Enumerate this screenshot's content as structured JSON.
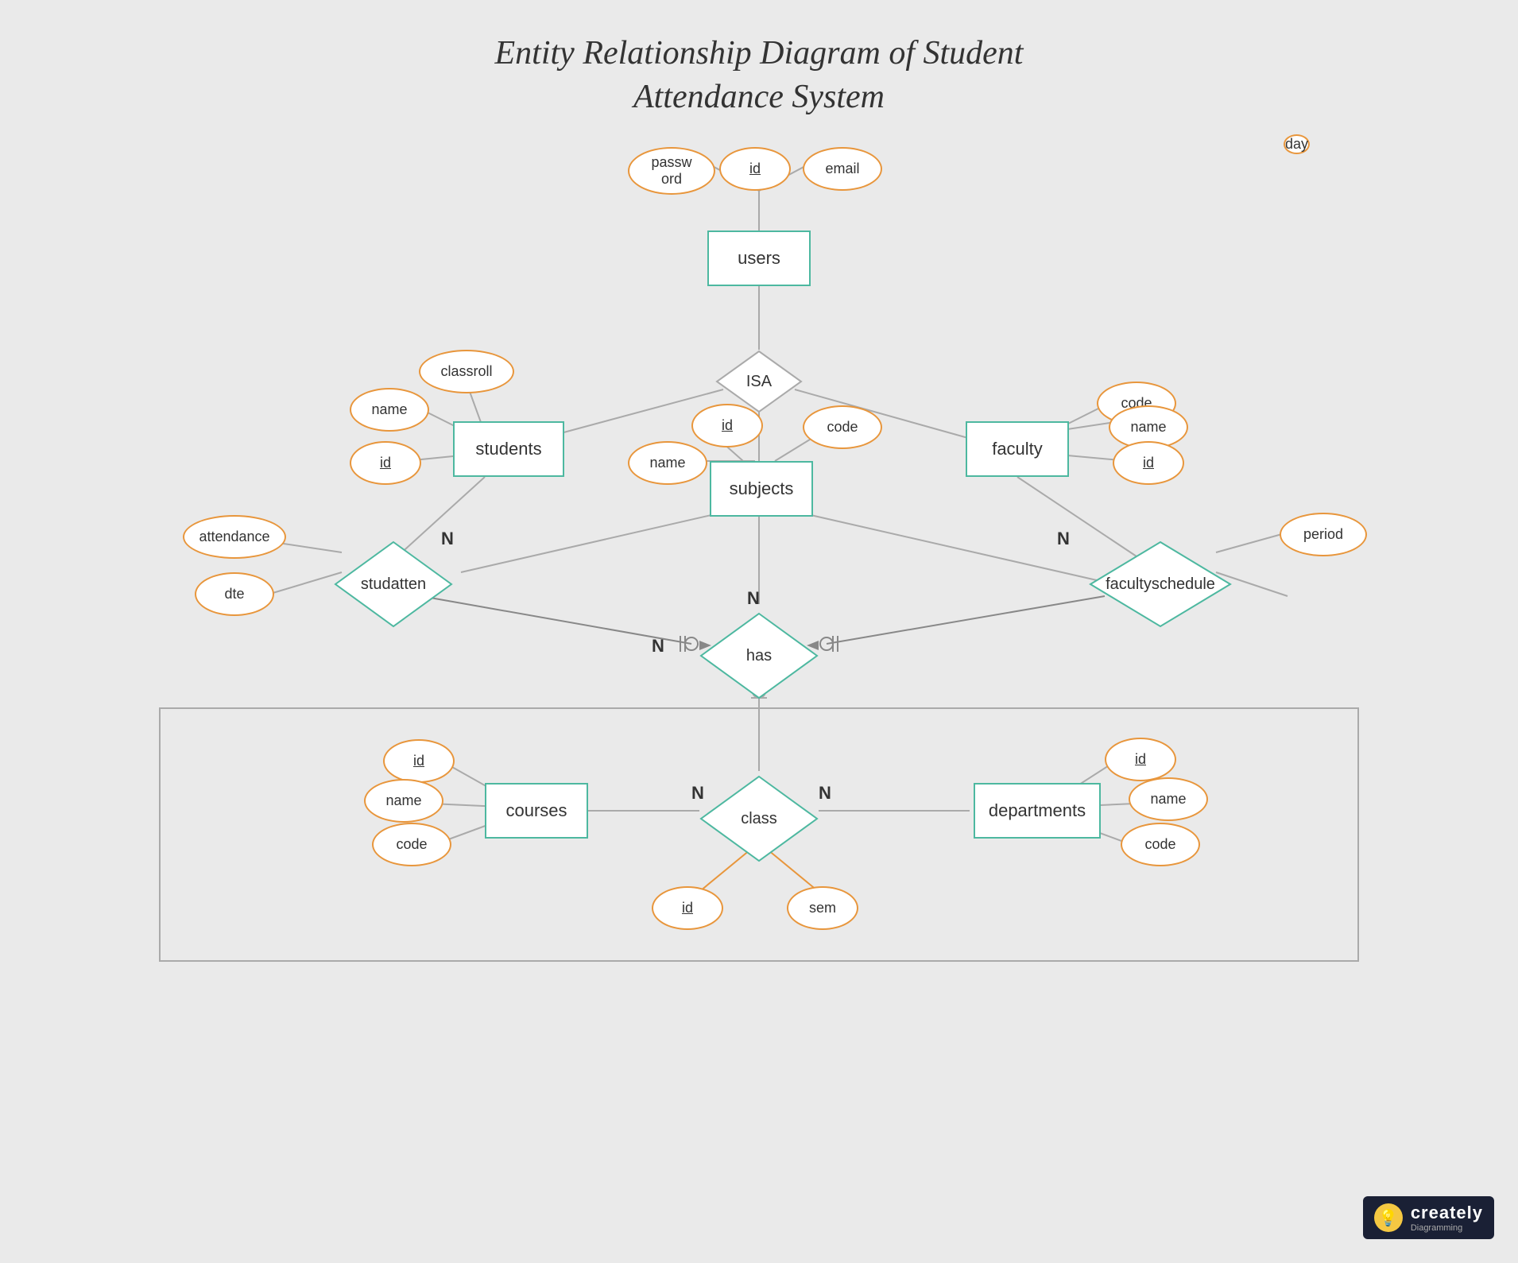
{
  "title": {
    "line1": "Entity Relationship Diagram of Student",
    "line2": "Attendance System"
  },
  "entities": {
    "users": "users",
    "students": "students",
    "faculty": "faculty",
    "subjects": "subjects",
    "courses": "courses",
    "departments": "departments"
  },
  "relationships": {
    "isa": "ISA",
    "studatten": "studatten",
    "has": "has",
    "class": "class",
    "facultyschedule": "facultyschedule"
  },
  "attributes": {
    "users_id": "id",
    "users_password": "password",
    "users_email": "email",
    "students_name": "name",
    "students_classroll": "classroll",
    "students_id": "id",
    "faculty_code": "code",
    "faculty_name": "name",
    "faculty_id": "id",
    "subjects_id": "id",
    "subjects_name": "name",
    "subjects_code": "code",
    "studatten_attendance": "attendance",
    "studatten_dte": "dte",
    "facultyschedule_period": "period",
    "facultyschedule_day": "day",
    "courses_id": "id",
    "courses_name": "name",
    "courses_code": "code",
    "departments_id": "id",
    "departments_name": "name",
    "departments_code": "code",
    "class_id": "id",
    "class_sem": "sem"
  },
  "logo": {
    "brand": "creately",
    "sub": "Diagramming"
  }
}
